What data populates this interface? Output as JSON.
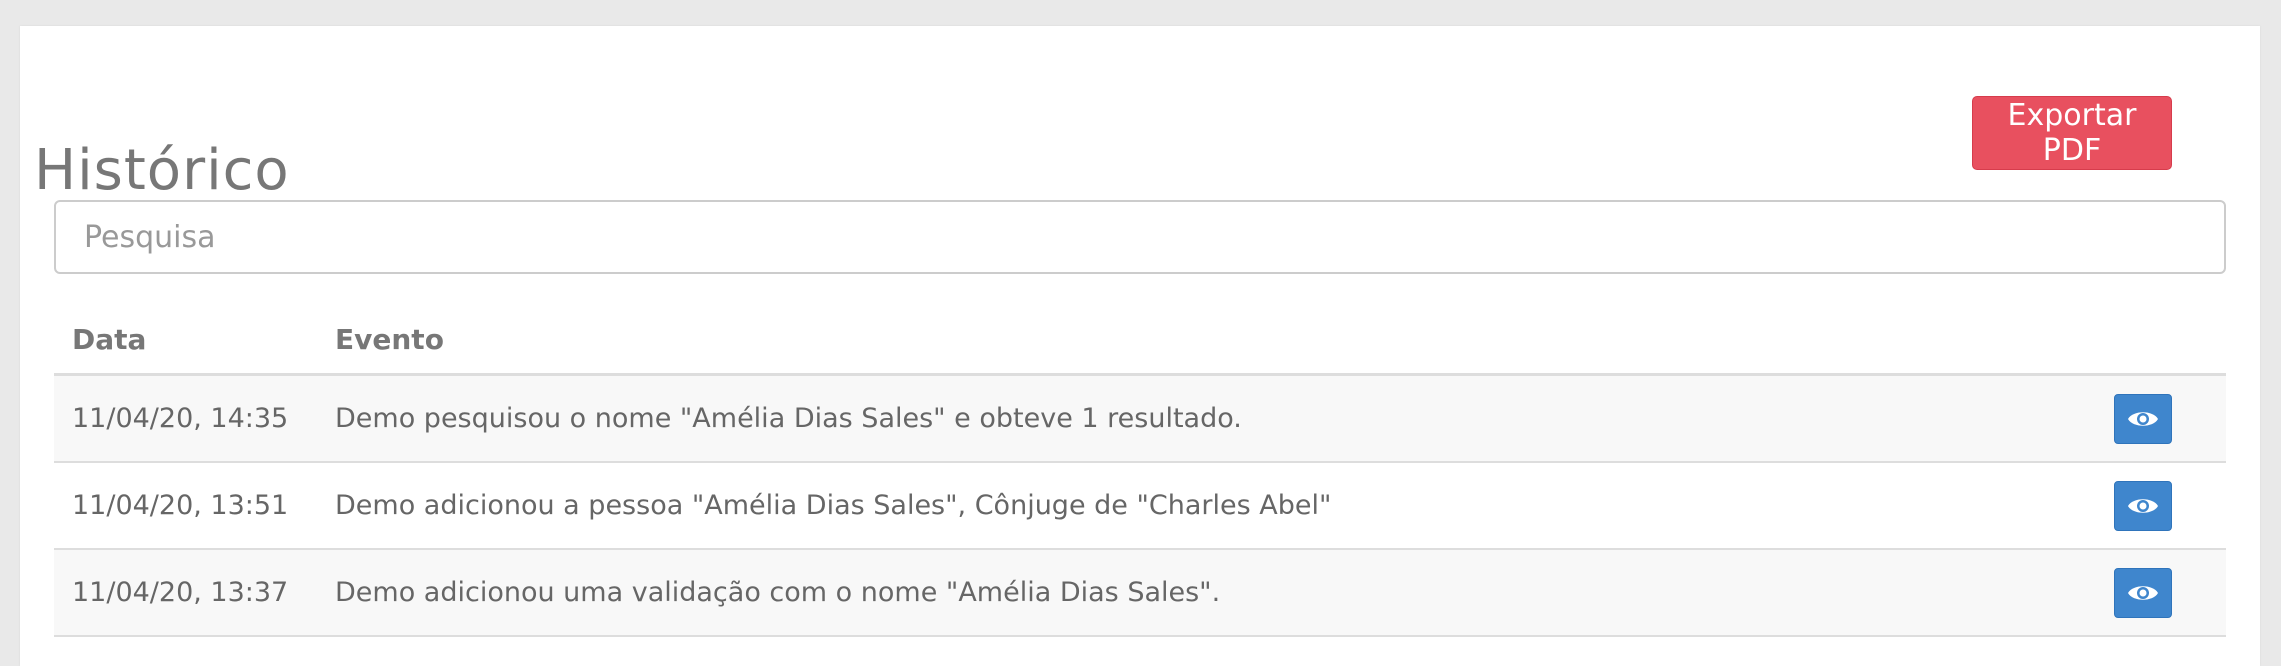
{
  "page": {
    "title": "Histórico",
    "export_label": "Exportar PDF"
  },
  "search": {
    "placeholder": "Pesquisa"
  },
  "table": {
    "headers": {
      "date": "Data",
      "event": "Evento"
    },
    "rows": [
      {
        "date": "11/04/20, 14:35",
        "event": "Demo pesquisou o nome \"Amélia Dias Sales\" e obteve 1 resultado.",
        "action_icon": "eye-icon"
      },
      {
        "date": "11/04/20, 13:51",
        "event": "Demo adicionou a pessoa \"Amélia Dias Sales\", Cônjuge de \"Charles Abel\"",
        "action_icon": "eye-icon"
      },
      {
        "date": "11/04/20, 13:37",
        "event": "Demo adicionou uma validação com o nome \"Amélia Dias Sales\".",
        "action_icon": "eye-icon"
      }
    ]
  },
  "colors": {
    "export_button": "#e8505f",
    "view_button": "#3f86cd"
  }
}
